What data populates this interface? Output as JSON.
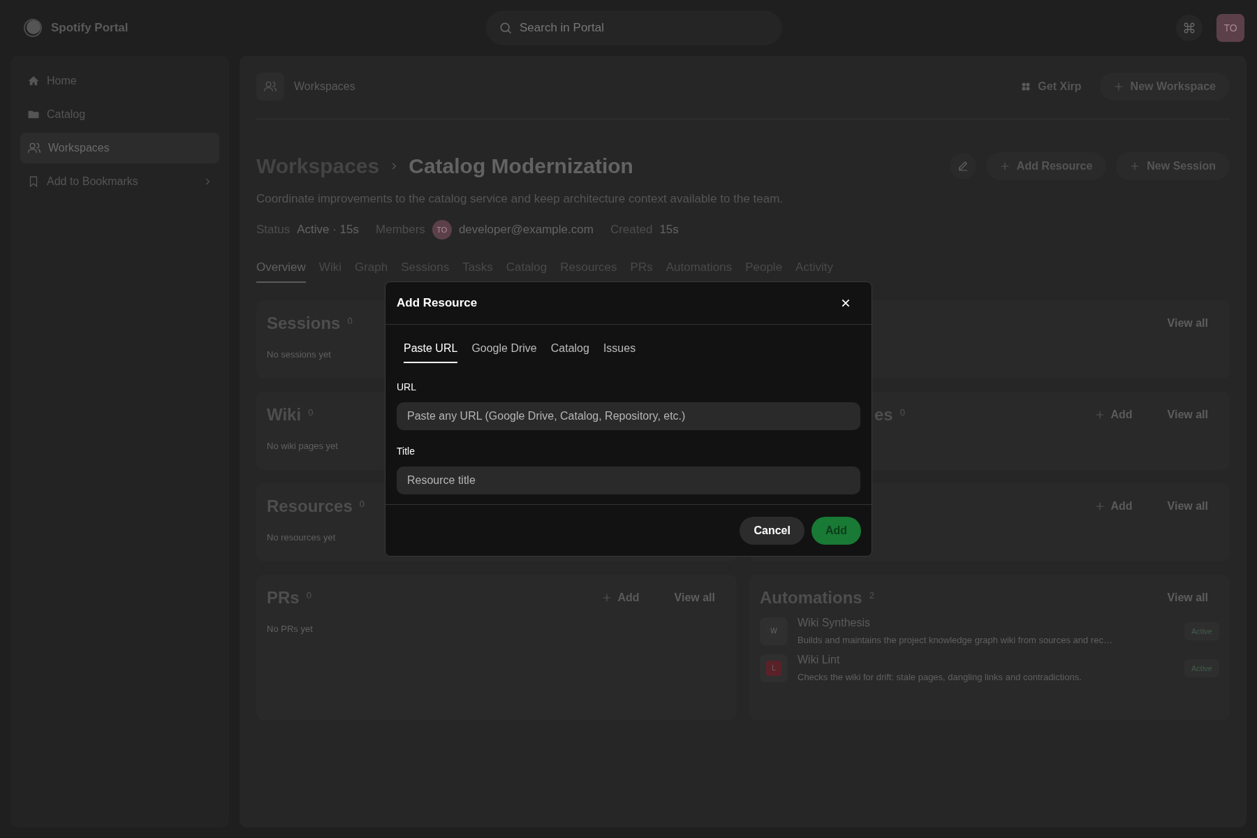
{
  "topbar": {
    "brand": "Spotify Portal",
    "search": {
      "placeholder": "Search in Portal"
    },
    "avatar": "TO"
  },
  "sidebar": {
    "items": [
      {
        "label": "Home",
        "selected": false,
        "has_submenu": false
      },
      {
        "label": "Catalog",
        "selected": false,
        "has_submenu": false
      },
      {
        "label": "Workspaces",
        "selected": true,
        "has_submenu": false
      },
      {
        "label": "Add to Bookmarks",
        "selected": false,
        "has_submenu": true
      }
    ]
  },
  "header": {
    "title": "Workspaces",
    "actions": [
      {
        "kind": "link",
        "label": "Get Xirp"
      },
      {
        "kind": "pill",
        "label": "New Workspace"
      }
    ]
  },
  "workspace": {
    "breadcrumb": "Workspaces",
    "title": "Catalog Modernization",
    "actions": [
      "Add Resource",
      "New Session"
    ],
    "description": "Coordinate improvements to the catalog service and keep architecture context available to the team.",
    "meta": [
      {
        "kind": "text",
        "label": "Status",
        "value": "Active · 15s"
      },
      {
        "kind": "member",
        "label": "Members",
        "avatar": "TO",
        "value": "developer@example.com"
      },
      {
        "kind": "text",
        "label": "Created",
        "value": "15s"
      }
    ],
    "tabs": [
      {
        "label": "Overview",
        "selected": true
      },
      {
        "label": "Wiki",
        "selected": false
      },
      {
        "label": "Graph",
        "selected": false
      },
      {
        "label": "Sessions",
        "selected": false
      },
      {
        "label": "Tasks",
        "selected": false
      },
      {
        "label": "Catalog",
        "selected": false
      },
      {
        "label": "Resources",
        "selected": false
      },
      {
        "label": "PRs",
        "selected": false
      },
      {
        "label": "Automations",
        "selected": false
      },
      {
        "label": "People",
        "selected": false
      },
      {
        "label": "Activity",
        "selected": false
      }
    ]
  },
  "cards": [
    {
      "title": "Sessions",
      "count": "0",
      "empty": "No sessions yet"
    },
    {
      "view_all": "View all"
    },
    {
      "title": "Wiki",
      "count": "0",
      "empty": "No wiki pages yet"
    },
    {
      "title": "es",
      "cut_off": true,
      "count": "0",
      "add": "Add",
      "view_all": "View all"
    },
    {
      "title": "Resources",
      "count": "0",
      "empty": "No resources yet"
    },
    {
      "add": "Add",
      "view_all": "View all"
    },
    {
      "title": "PRs",
      "count": "0",
      "add": "Add",
      "view_all": "View all",
      "empty": "No PRs yet"
    },
    {
      "title": "Automations",
      "count": "2",
      "view_all": "View all",
      "items": [
        {
          "letter": "W",
          "color": "#303030",
          "name": "Wiki Synthesis",
          "description": "Builds and maintains the project knowledge graph wiki from sources and rec…",
          "status": "Active"
        },
        {
          "letter": "L",
          "color": "#5a2228",
          "name": "Wiki Lint",
          "description": "Checks the wiki for drift: stale pages, dangling links and contradictions.",
          "status": "Active"
        }
      ]
    }
  ],
  "modal": {
    "title": "Add Resource",
    "tabs": [
      {
        "label": "Paste URL",
        "selected": true
      },
      {
        "label": "Google Drive",
        "selected": false
      },
      {
        "label": "Catalog",
        "selected": false
      },
      {
        "label": "Issues",
        "selected": false
      }
    ],
    "fields": [
      {
        "label": "URL",
        "placeholder": "Paste any URL (Google Drive, Catalog, Repository, etc.)"
      },
      {
        "label": "Title",
        "placeholder": "Resource title"
      }
    ],
    "buttons": [
      {
        "kind": "secondary",
        "label": "Cancel"
      },
      {
        "kind": "primary",
        "label": "Add"
      }
    ]
  }
}
